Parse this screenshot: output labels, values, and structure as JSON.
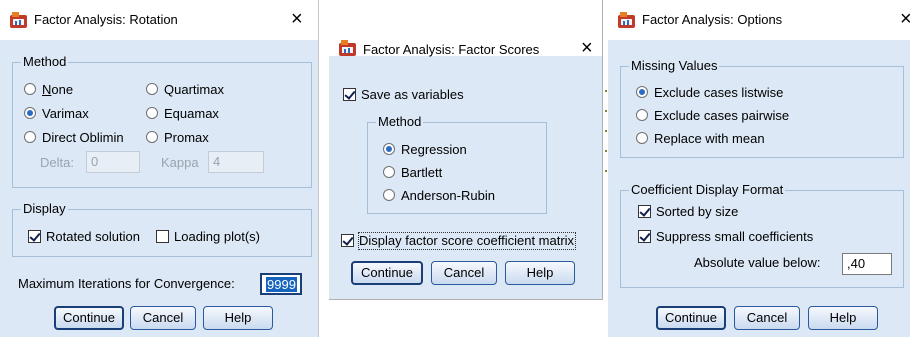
{
  "rotation": {
    "title": "Factor Analysis: Rotation",
    "close": "×",
    "method_group": "Method",
    "none": "None",
    "quartimax": "Quartimax",
    "varimax": "Varimax",
    "equamax": "Equamax",
    "direct_oblimin": "Direct Oblimin",
    "promax": "Promax",
    "delta_label": "Delta:",
    "delta_value": "0",
    "kappa_label": "Kappa",
    "kappa_value": "4",
    "display_group": "Display",
    "rotated_solution": "Rotated solution",
    "loading_plots": "Loading plot(s)",
    "max_iter_label": "Maximum Iterations for Convergence:",
    "max_iter_value": "9999",
    "continue": "Continue",
    "cancel": "Cancel",
    "help": "Help"
  },
  "scores": {
    "title": "Factor Analysis: Factor Scores",
    "close": "×",
    "save_as_variables": "Save as variables",
    "method_group": "Method",
    "regression": "Regression",
    "bartlett": "Bartlett",
    "anderson_rubin": "Anderson-Rubin",
    "display_matrix": "Display factor score coefficient matrix",
    "continue": "Continue",
    "cancel": "Cancel",
    "help": "Help"
  },
  "options": {
    "title": "Factor Analysis: Options",
    "close": "×",
    "missing_group": "Missing Values",
    "listwise": "Exclude cases listwise",
    "pairwise": "Exclude cases pairwise",
    "replace_mean": "Replace with mean",
    "coef_group": "Coefficient Display Format",
    "sorted": "Sorted by size",
    "suppress": "Suppress small coefficients",
    "abs_label": "Absolute value below:",
    "abs_value": ",40",
    "continue": "Continue",
    "cancel": "Cancel",
    "help": "Help"
  },
  "colors": {
    "dialog_bg": "#dce8f5",
    "accent": "#1565c0"
  },
  "icons": {
    "app": "spss-app-icon",
    "close": "close-icon"
  }
}
